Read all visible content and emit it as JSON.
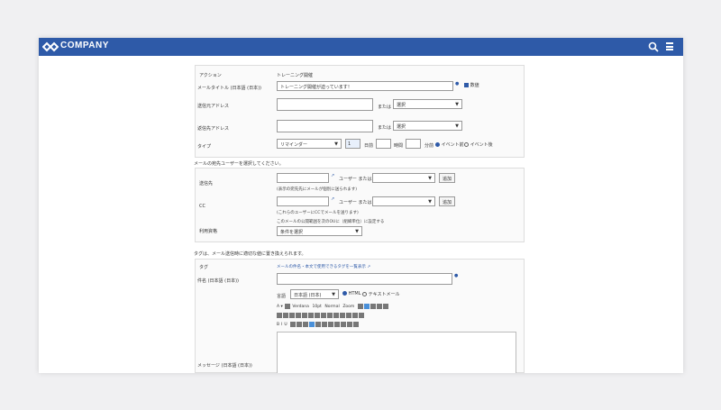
{
  "header": {
    "brand": "COMPANY"
  },
  "action": {
    "label": "アクション",
    "value": "トレーニング開催",
    "mail_title_label": "メールタイトル (日本語 (日本))",
    "mail_title_value": "トレーニング開催が迫っています！",
    "draft_label": "数値",
    "from_label": "送信元アドレス",
    "or1": "または",
    "from_select": "選択",
    "reply_label": "返信先アドレス",
    "or2": "または",
    "reply_select": "選択",
    "type_label": "タイプ",
    "type_select": "リマインダー",
    "num": "1",
    "day": "日前",
    "hour": "時間",
    "minute": "分前",
    "event_before": "イベント前",
    "event_after": "イベント後"
  },
  "recipients": {
    "title": "メールの宛先ユーザーを選択してください。",
    "to_label": "送信先",
    "user_or": "ユーザー または",
    "add": "追加",
    "to_note": "(表示の宛先先にメールが個別に送られます)",
    "cc_label": "CC",
    "cc_user_or": "ユーザー または",
    "cc_add": "追加",
    "cc_note": "(これらのユーザーにCCでメールを送ります)",
    "scope_label": "利用資格",
    "scope_note": "このメールの公開範囲を次のOUに（組織単位）に設定する",
    "scope_select": "条件を選択"
  },
  "tag_section": {
    "title": "タグは、メール送信時に適切な値に置き換えられます。",
    "tag_label": "タグ",
    "tag_link": "メールの件名・本文で使用できるタグを一覧表示",
    "subject_label": "件名 (日本語 (日本))",
    "lang_label": "言語",
    "lang_select": "日本語 (日本)",
    "html": "HTML",
    "text": "テキストメール",
    "message_label": "メッセージ (日本語 (日本))"
  },
  "toolbar": {
    "font": "Verdana",
    "size": "10pt",
    "format": "Normal",
    "zoom": "Zoom"
  }
}
